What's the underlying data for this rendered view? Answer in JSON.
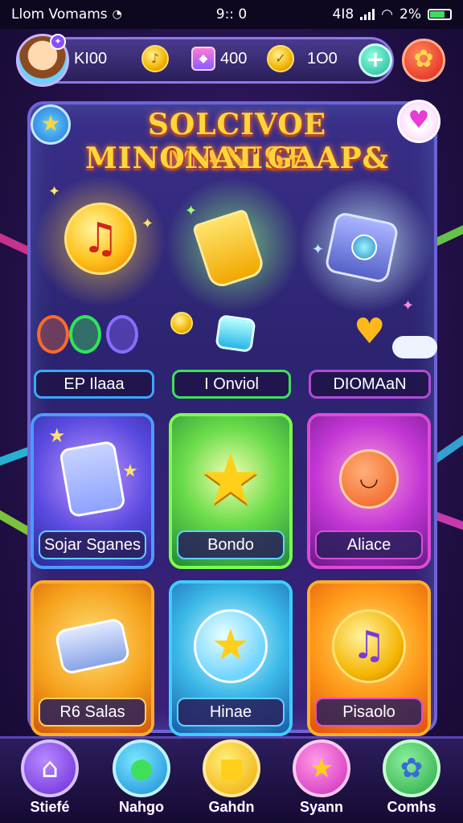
{
  "status_bar": {
    "carrier": "Llom Vomams",
    "time": "9:: 0",
    "network": "4I8",
    "battery": "2%"
  },
  "top_bar": {
    "resource_1": "KI00",
    "resource_2": "400",
    "resource_3": "1O0"
  },
  "title": {
    "line1": "SOLCIVOE MANISE",
    "line2": "MINONAT GAAP&"
  },
  "showcase_labels": [
    "EP Ilaaa",
    "I Onviol",
    "DIOMAaN"
  ],
  "cards": [
    {
      "label": "Sojar Sganes",
      "icon": "crystal-card-icon",
      "color": "#2f6fe0"
    },
    {
      "label": "Bondo",
      "icon": "star-icon",
      "color": "#3ec54a"
    },
    {
      "label": "Aliace",
      "icon": "cute-creature-icon",
      "color": "#c236d4"
    },
    {
      "label": "R6 Salas",
      "icon": "game-controller-icon",
      "color": "#f18a1a"
    },
    {
      "label": "Hinae",
      "icon": "star-bubble-icon",
      "color": "#28b6e8"
    },
    {
      "label": "Pisaolo",
      "icon": "music-note-icon",
      "color": "#ff8a1a"
    }
  ],
  "nav": [
    {
      "label": "Stiefé",
      "icon": "home-icon"
    },
    {
      "label": "Nahgo",
      "icon": "chat-bubble-icon"
    },
    {
      "label": "Gahdn",
      "icon": "gift-box-icon"
    },
    {
      "label": "Syann",
      "icon": "star-icon"
    },
    {
      "label": "Comhs",
      "icon": "gear-icon"
    }
  ]
}
